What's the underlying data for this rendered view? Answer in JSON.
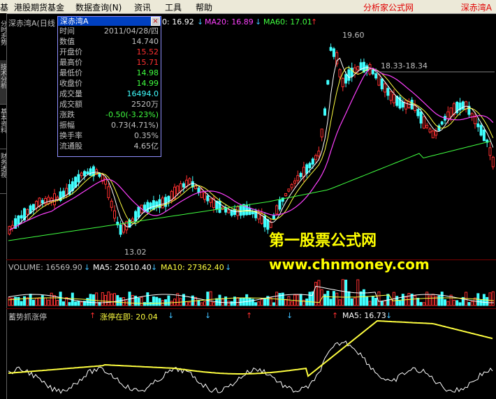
{
  "menubar": {
    "items": [
      "港股期货基金",
      "数据查询(N)",
      "资讯",
      "工具",
      "帮助"
    ],
    "leading": "基",
    "brand": "分析家公式网",
    "brand_stock": "深赤湾A"
  },
  "sidebar": {
    "tabs": [
      "分时走势",
      "技术分析",
      "基本资料",
      "财务透视"
    ]
  },
  "chart_header": {
    "stock_name": "深赤湾A",
    "period": "(日线",
    "ma_prefix": "0: 16.92",
    "ma20": "MA20: 16.89",
    "ma60": "MA60: 17.01",
    "colors": {
      "ma10": "#ffffff",
      "ma20": "#ff40ff",
      "ma60": "#40ff40"
    }
  },
  "infobox": {
    "title": "深赤湾A",
    "close_label": "×",
    "rows": [
      {
        "label": "时间",
        "value": "2011/04/28/四",
        "color": "#c0c0c0"
      },
      {
        "label": "数值",
        "value": "14.740",
        "color": "#c0c0c0"
      },
      {
        "label": "开盘价",
        "value": "15.52",
        "color": "#ff3030"
      },
      {
        "label": "最高价",
        "value": "15.71",
        "color": "#ff3030"
      },
      {
        "label": "最低价",
        "value": "14.98",
        "color": "#40ff40"
      },
      {
        "label": "收盘价",
        "value": "14.99",
        "color": "#40ff40"
      },
      {
        "label": "成交量",
        "value": "16494.0",
        "color": "#40ffff"
      },
      {
        "label": "成交额",
        "value": "2520万",
        "color": "#c0c0c0"
      },
      {
        "label": "涨跌",
        "value": "-0.50(-3.23%)",
        "color": "#40ff40"
      },
      {
        "label": "振幅",
        "value": "0.73(4.71%)",
        "color": "#c0c0c0"
      },
      {
        "label": "换手率",
        "value": "0.35%",
        "color": "#c0c0c0"
      },
      {
        "label": "流通股",
        "value": "4.65亿",
        "color": "#c0c0c0"
      }
    ]
  },
  "annotations": {
    "high": "19.60",
    "range": "18.33-18.34",
    "low": "13.02"
  },
  "volume_panel": {
    "volume": "VOLUME: 16569.90",
    "ma5": "MA5: 25010.40",
    "ma10": "MA10: 27362.40"
  },
  "indicator_panel": {
    "name": "蓄势抓涨停",
    "line1": "涨停在即: 20.04",
    "line2": "MA5: 16.73"
  },
  "watermark": {
    "line1": "第一股票公式网",
    "line2": "www.chnmoney.com"
  },
  "chart_data": {
    "type": "candlestick",
    "annotations": {
      "high": 19.6,
      "low": 13.02,
      "range_label": "18.33-18.34"
    },
    "last_ma": {
      "ma20": 16.89,
      "ma60": 17.01
    },
    "series_colors": {
      "up": "#ff3030",
      "down": "#40ffff",
      "ma_white": "#ffffff",
      "ma_yellow": "#ffff40",
      "ma_magenta": "#ff40ff",
      "ma_green": "#40ff40"
    }
  }
}
